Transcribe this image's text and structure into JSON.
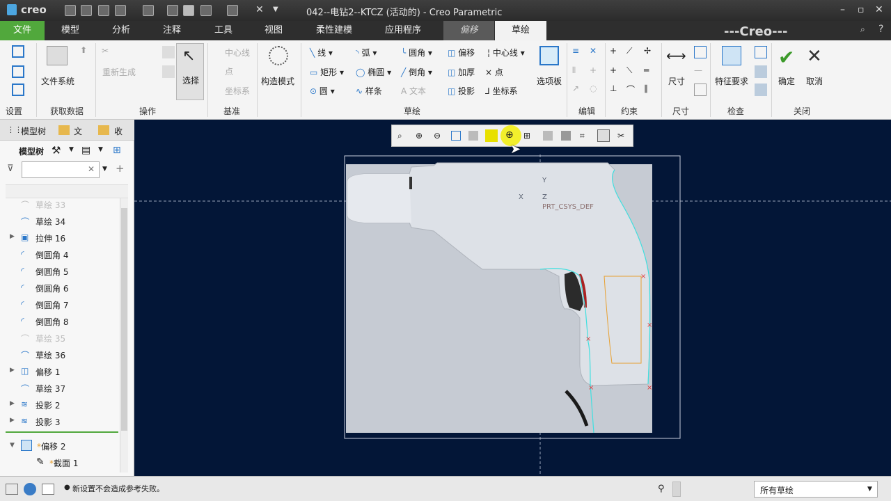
{
  "app": {
    "logo": "creo",
    "title": "042--电钻2--KTCZ (活动的) - Creo Parametric",
    "watermark": "---Creo---"
  },
  "tabs": [
    "文件",
    "模型",
    "分析",
    "注释",
    "工具",
    "视图",
    "柔性建模",
    "应用程序",
    "偏移",
    "草绘"
  ],
  "ribbon": {
    "settings": {
      "group": "设置"
    },
    "get_data": {
      "file_system": "文件系统",
      "group": "获取数据"
    },
    "operations": {
      "regenerate": "重新生成",
      "select": "选择",
      "group": "操作"
    },
    "datum": {
      "centerline": "中心线",
      "point": "点",
      "csys": "坐标系",
      "group": "基准"
    },
    "construction": {
      "label": "构造模式"
    },
    "sketch": {
      "line": "线",
      "arc": "弧",
      "fillet": "圆角",
      "offset": "偏移",
      "centerline": "中心线",
      "rectangle": "矩形",
      "ellipse": "椭圆",
      "chamfer": "倒角",
      "thicken": "加厚",
      "point": "点",
      "circle": "圆",
      "spline": "样条",
      "text": "文本",
      "project": "投影",
      "csys": "坐标系",
      "palette": "选项板",
      "group": "草绘"
    },
    "edit": {
      "group": "编辑"
    },
    "constrain": {
      "group": "约束"
    },
    "dimension": {
      "label": "尺寸",
      "group": "尺寸"
    },
    "inspect": {
      "feature_req": "特征要求",
      "group": "检查"
    },
    "close": {
      "ok": "确定",
      "cancel": "取消",
      "group": "关闭"
    }
  },
  "sidebar": {
    "tabs": [
      "模型树",
      "文",
      "收"
    ],
    "header": "模型树",
    "filter_placeholder": "",
    "items": [
      {
        "label": "草绘 33",
        "dim": true,
        "expandable": false,
        "icon": "sketch-icon"
      },
      {
        "label": "草绘 34",
        "dim": false,
        "expandable": false,
        "icon": "sketch-icon"
      },
      {
        "label": "拉伸 16",
        "dim": false,
        "expandable": true,
        "icon": "extrude-icon"
      },
      {
        "label": "倒圆角 4",
        "dim": false,
        "expandable": false,
        "icon": "round-icon"
      },
      {
        "label": "倒圆角 5",
        "dim": false,
        "expandable": false,
        "icon": "round-icon"
      },
      {
        "label": "倒圆角 6",
        "dim": false,
        "expandable": false,
        "icon": "round-icon"
      },
      {
        "label": "倒圆角 7",
        "dim": false,
        "expandable": false,
        "icon": "round-icon"
      },
      {
        "label": "倒圆角 8",
        "dim": false,
        "expandable": false,
        "icon": "round-icon"
      },
      {
        "label": "草绘 35",
        "dim": true,
        "expandable": false,
        "icon": "sketch-icon"
      },
      {
        "label": "草绘 36",
        "dim": false,
        "expandable": false,
        "icon": "sketch-icon"
      },
      {
        "label": "偏移 1",
        "dim": false,
        "expandable": true,
        "icon": "offset-icon"
      },
      {
        "label": "草绘 37",
        "dim": false,
        "expandable": false,
        "icon": "sketch-icon"
      },
      {
        "label": "投影 2",
        "dim": false,
        "expandable": true,
        "icon": "projection-icon"
      },
      {
        "label": "投影 3",
        "dim": false,
        "expandable": true,
        "icon": "projection-icon"
      }
    ],
    "active_feature": "偏移 2",
    "active_child": "截面 1"
  },
  "canvas": {
    "axis_y": "Y",
    "axis_z": "Z",
    "axis_x": "X",
    "csys_label": "PRT_CSYS_DEF"
  },
  "status": {
    "message": "新设置不会造成参考失败。",
    "filter_value": "所有草绘"
  },
  "colors": {
    "file_tab": "#51a83c",
    "canvas_bg": "#031637",
    "sketch_cyan": "#3fe0e0",
    "sketch_orange": "#e8a030"
  }
}
